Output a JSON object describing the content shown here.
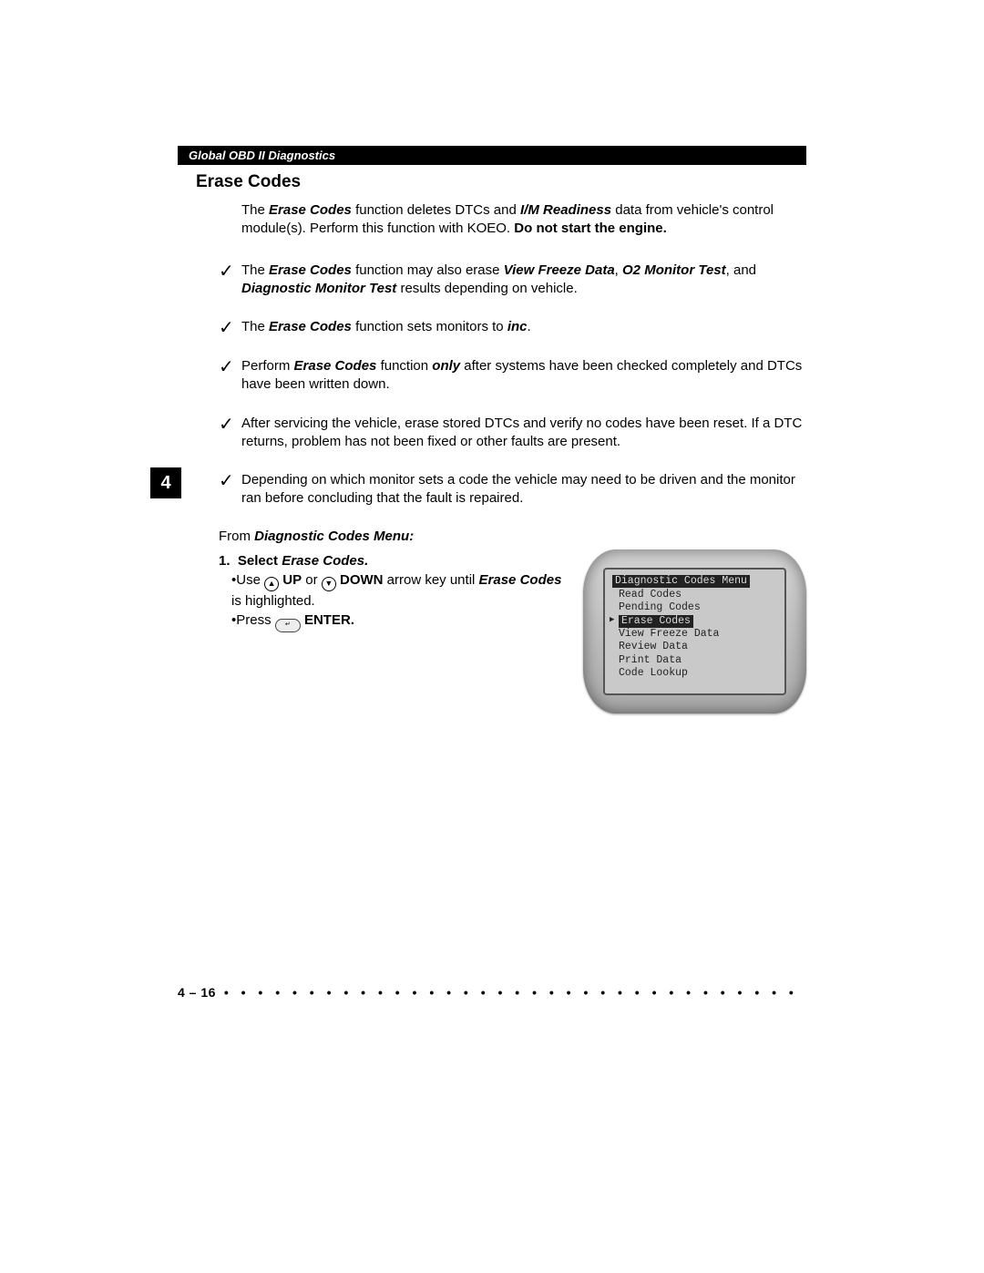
{
  "header": "Global OBD II Diagnostics",
  "chapter_tab": "4",
  "title": "Erase Codes",
  "intro": {
    "pre": "The ",
    "em1": "Erase Codes",
    "mid1": " function deletes DTCs and ",
    "em2": "I/M Readiness",
    "mid2": " data from vehicle's control module(s). Perform this function with KOEO. ",
    "strong_tail": "Do not start the engine."
  },
  "checks": [
    {
      "pre": "The ",
      "b1": "Erase Codes",
      "mid1": " function may also erase ",
      "b2": "View Freeze Data",
      "mid2": ", ",
      "b3": "O2 Monitor Test",
      "mid3": ", and ",
      "b4": "Diagnostic Monitor Test",
      "tail": " results depending on vehicle."
    },
    {
      "pre": "The ",
      "b1": "Erase Codes",
      "mid1": " function sets monitors to ",
      "b2": "inc",
      "tail": "."
    },
    {
      "pre": "Perform ",
      "b1": "Erase Codes",
      "mid1": " function ",
      "b2": "only",
      "tail": " after systems have been checked completely and DTCs have been written down."
    },
    {
      "plain": "After servicing the vehicle, erase stored DTCs and verify no codes have been reset. If a DTC returns, problem has not been fixed or other faults are present."
    },
    {
      "plain": "Depending on which monitor sets a code the vehicle may need to be driven and the monitor ran before concluding that the fault is repaired."
    }
  ],
  "from_line": {
    "pre": "From ",
    "em": "Diagnostic Codes Menu:"
  },
  "step1": {
    "number": "1.",
    "title_pre": "Select ",
    "title_em": "Erase Codes.",
    "line1_pre": "Use ",
    "up_label": "UP",
    "line1_mid": " or ",
    "down_label": "DOWN",
    "line1_tail": " arrow key until ",
    "line1_em": "Erase Codes",
    "line1_end": " is highlighted.",
    "line2_pre": "Press ",
    "enter_label": "ENTER."
  },
  "lcd": {
    "title": "Diagnostic Codes Menu",
    "items": [
      "Read Codes",
      "Pending Codes",
      "Erase Codes",
      "View Freeze Data",
      "Review Data",
      "Print Data",
      "Code Lookup"
    ],
    "selected_index": 2
  },
  "footer": {
    "page": "4 – 16",
    "dots": " • • • • • • • • • • • • • • • • • • • • • • • • • • • • • • • • • • • • • • • • • • • • • • • • • • • • •"
  }
}
